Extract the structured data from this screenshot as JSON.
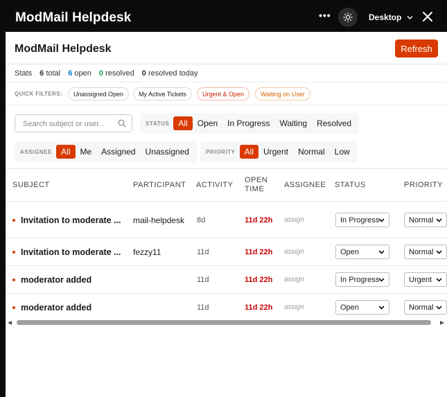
{
  "window": {
    "title": "ModMail Helpdesk",
    "more_icon": "more-horizontal-icon",
    "theme_icon": "sun-icon",
    "device_label": "Desktop",
    "close_icon": "close-icon"
  },
  "header": {
    "title": "ModMail Helpdesk",
    "refresh_label": "Refresh"
  },
  "stats": {
    "label": "Stats",
    "total_count": "6",
    "total_label": "total",
    "open_count": "6",
    "open_label": "open",
    "resolved_count": "0",
    "resolved_label": "resolved",
    "resolved_today_count": "0",
    "resolved_today_label": "resolved today"
  },
  "quick_filters": {
    "label": "QUICK FILTERS:",
    "items": [
      "Unassigned Open",
      "My Active Tickets",
      "Urgent & Open",
      "Waiting on User"
    ]
  },
  "search": {
    "placeholder": "Search subject or user..."
  },
  "status_filter": {
    "label": "STATUS",
    "options": [
      "All",
      "Open",
      "In Progress",
      "Waiting",
      "Resolved"
    ],
    "selected": "All"
  },
  "assignee_filter": {
    "label": "ASSIGNEE",
    "options": [
      "All",
      "Me",
      "Assigned",
      "Unassigned"
    ],
    "selected": "All"
  },
  "priority_filter": {
    "label": "PRIORITY",
    "options": [
      "All",
      "Urgent",
      "Normal",
      "Low"
    ],
    "selected": "All"
  },
  "table": {
    "columns": [
      "SUBJECT",
      "PARTICIPANT",
      "ACTIVITY",
      "OPEN TIME",
      "ASSIGNEE",
      "STATUS",
      "PRIORITY"
    ],
    "rows": [
      {
        "subject": "Invitation to moderate ...",
        "participant": "mail-helpdesk",
        "activity": "8d",
        "open_time": "11d 22h",
        "assignee": "assign",
        "status": "In Progress",
        "priority": "Normal"
      },
      {
        "subject": "Invitation to moderate ...",
        "participant": "fezzy11",
        "activity": "11d",
        "open_time": "11d 22h",
        "assignee": "assign",
        "status": "Open",
        "priority": "Normal"
      },
      {
        "subject": "moderator added",
        "participant": "",
        "activity": "11d",
        "open_time": "11d 22h",
        "assignee": "assign",
        "status": "In Progress",
        "priority": "Urgent"
      },
      {
        "subject": "moderator added",
        "participant": "",
        "activity": "11d",
        "open_time": "11d 22h",
        "assignee": "assign",
        "status": "Open",
        "priority": "Normal"
      }
    ]
  },
  "colors": {
    "accent": "#d93a00",
    "open_count": "#0079d3",
    "resolved_count": "#1f9d55",
    "open_time": "#cc0000"
  }
}
